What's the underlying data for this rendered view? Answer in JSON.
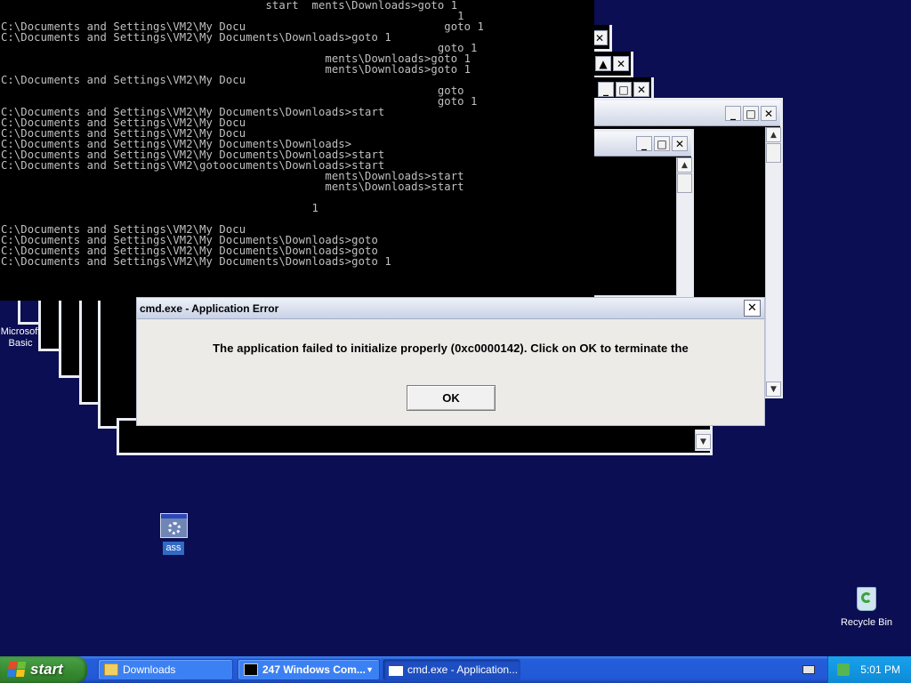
{
  "console": {
    "lines": [
      "                                        start  ments\\Downloads>goto 1",
      "                                                                     1",
      "C:\\Documents and Settings\\VM2\\My Docu                              goto 1",
      "C:\\Documents and Settings\\VM2\\My Documents\\Downloads>goto 1",
      "                                                                  goto 1",
      "                                                 ments\\Downloads>goto 1",
      "                                                 ments\\Downloads>goto 1",
      "C:\\Documents and Settings\\VM2\\My Docu",
      "                                                                  goto",
      "                                                                  goto 1",
      "C:\\Documents and Settings\\VM2\\My Documents\\Downloads>start",
      "C:\\Documents and Settings\\VM2\\My Docu",
      "C:\\Documents and Settings\\VM2\\My Docu",
      "C:\\Documents and Settings\\VM2\\My Documents\\Downloads>",
      "C:\\Documents and Settings\\VM2\\My Documents\\Downloads>start",
      "C:\\Documents and Settings\\VM2\\gotoocuments\\Downloads>start",
      "                                                 ments\\Downloads>start",
      "                                                 ments\\Downloads>start",
      "",
      "                                               1",
      "",
      "C:\\Documents and Settings\\VM2\\My Docu",
      "C:\\Documents and Settings\\VM2\\My Documents\\Downloads>goto",
      "C:\\Documents and Settings\\VM2\\My Documents\\Downloads>goto",
      "C:\\Documents and Settings\\VM2\\My Documents\\Downloads>goto 1"
    ]
  },
  "dialog": {
    "title": "cmd.exe - Application Error",
    "message": "The application failed to initialize properly (0xc0000142). Click on OK to terminate the",
    "ok_label": "OK",
    "close_glyph": "✕"
  },
  "window_buttons": {
    "minimize": "_",
    "maximize": "□",
    "close": "✕"
  },
  "desktop_icons": {
    "partial_label_line1": "Microsoft",
    "partial_label_line2": "Basic",
    "ass_label": "ass",
    "recycle_label": "Recycle Bin"
  },
  "taskbar": {
    "start_label": "start",
    "tasks": [
      {
        "label": "Downloads",
        "icon": "folder-icon"
      },
      {
        "label": "247 Windows Com...",
        "icon": "cmd-icon"
      },
      {
        "label": "cmd.exe - Application...",
        "icon": "window-icon"
      }
    ],
    "clock": "5:01 PM"
  }
}
